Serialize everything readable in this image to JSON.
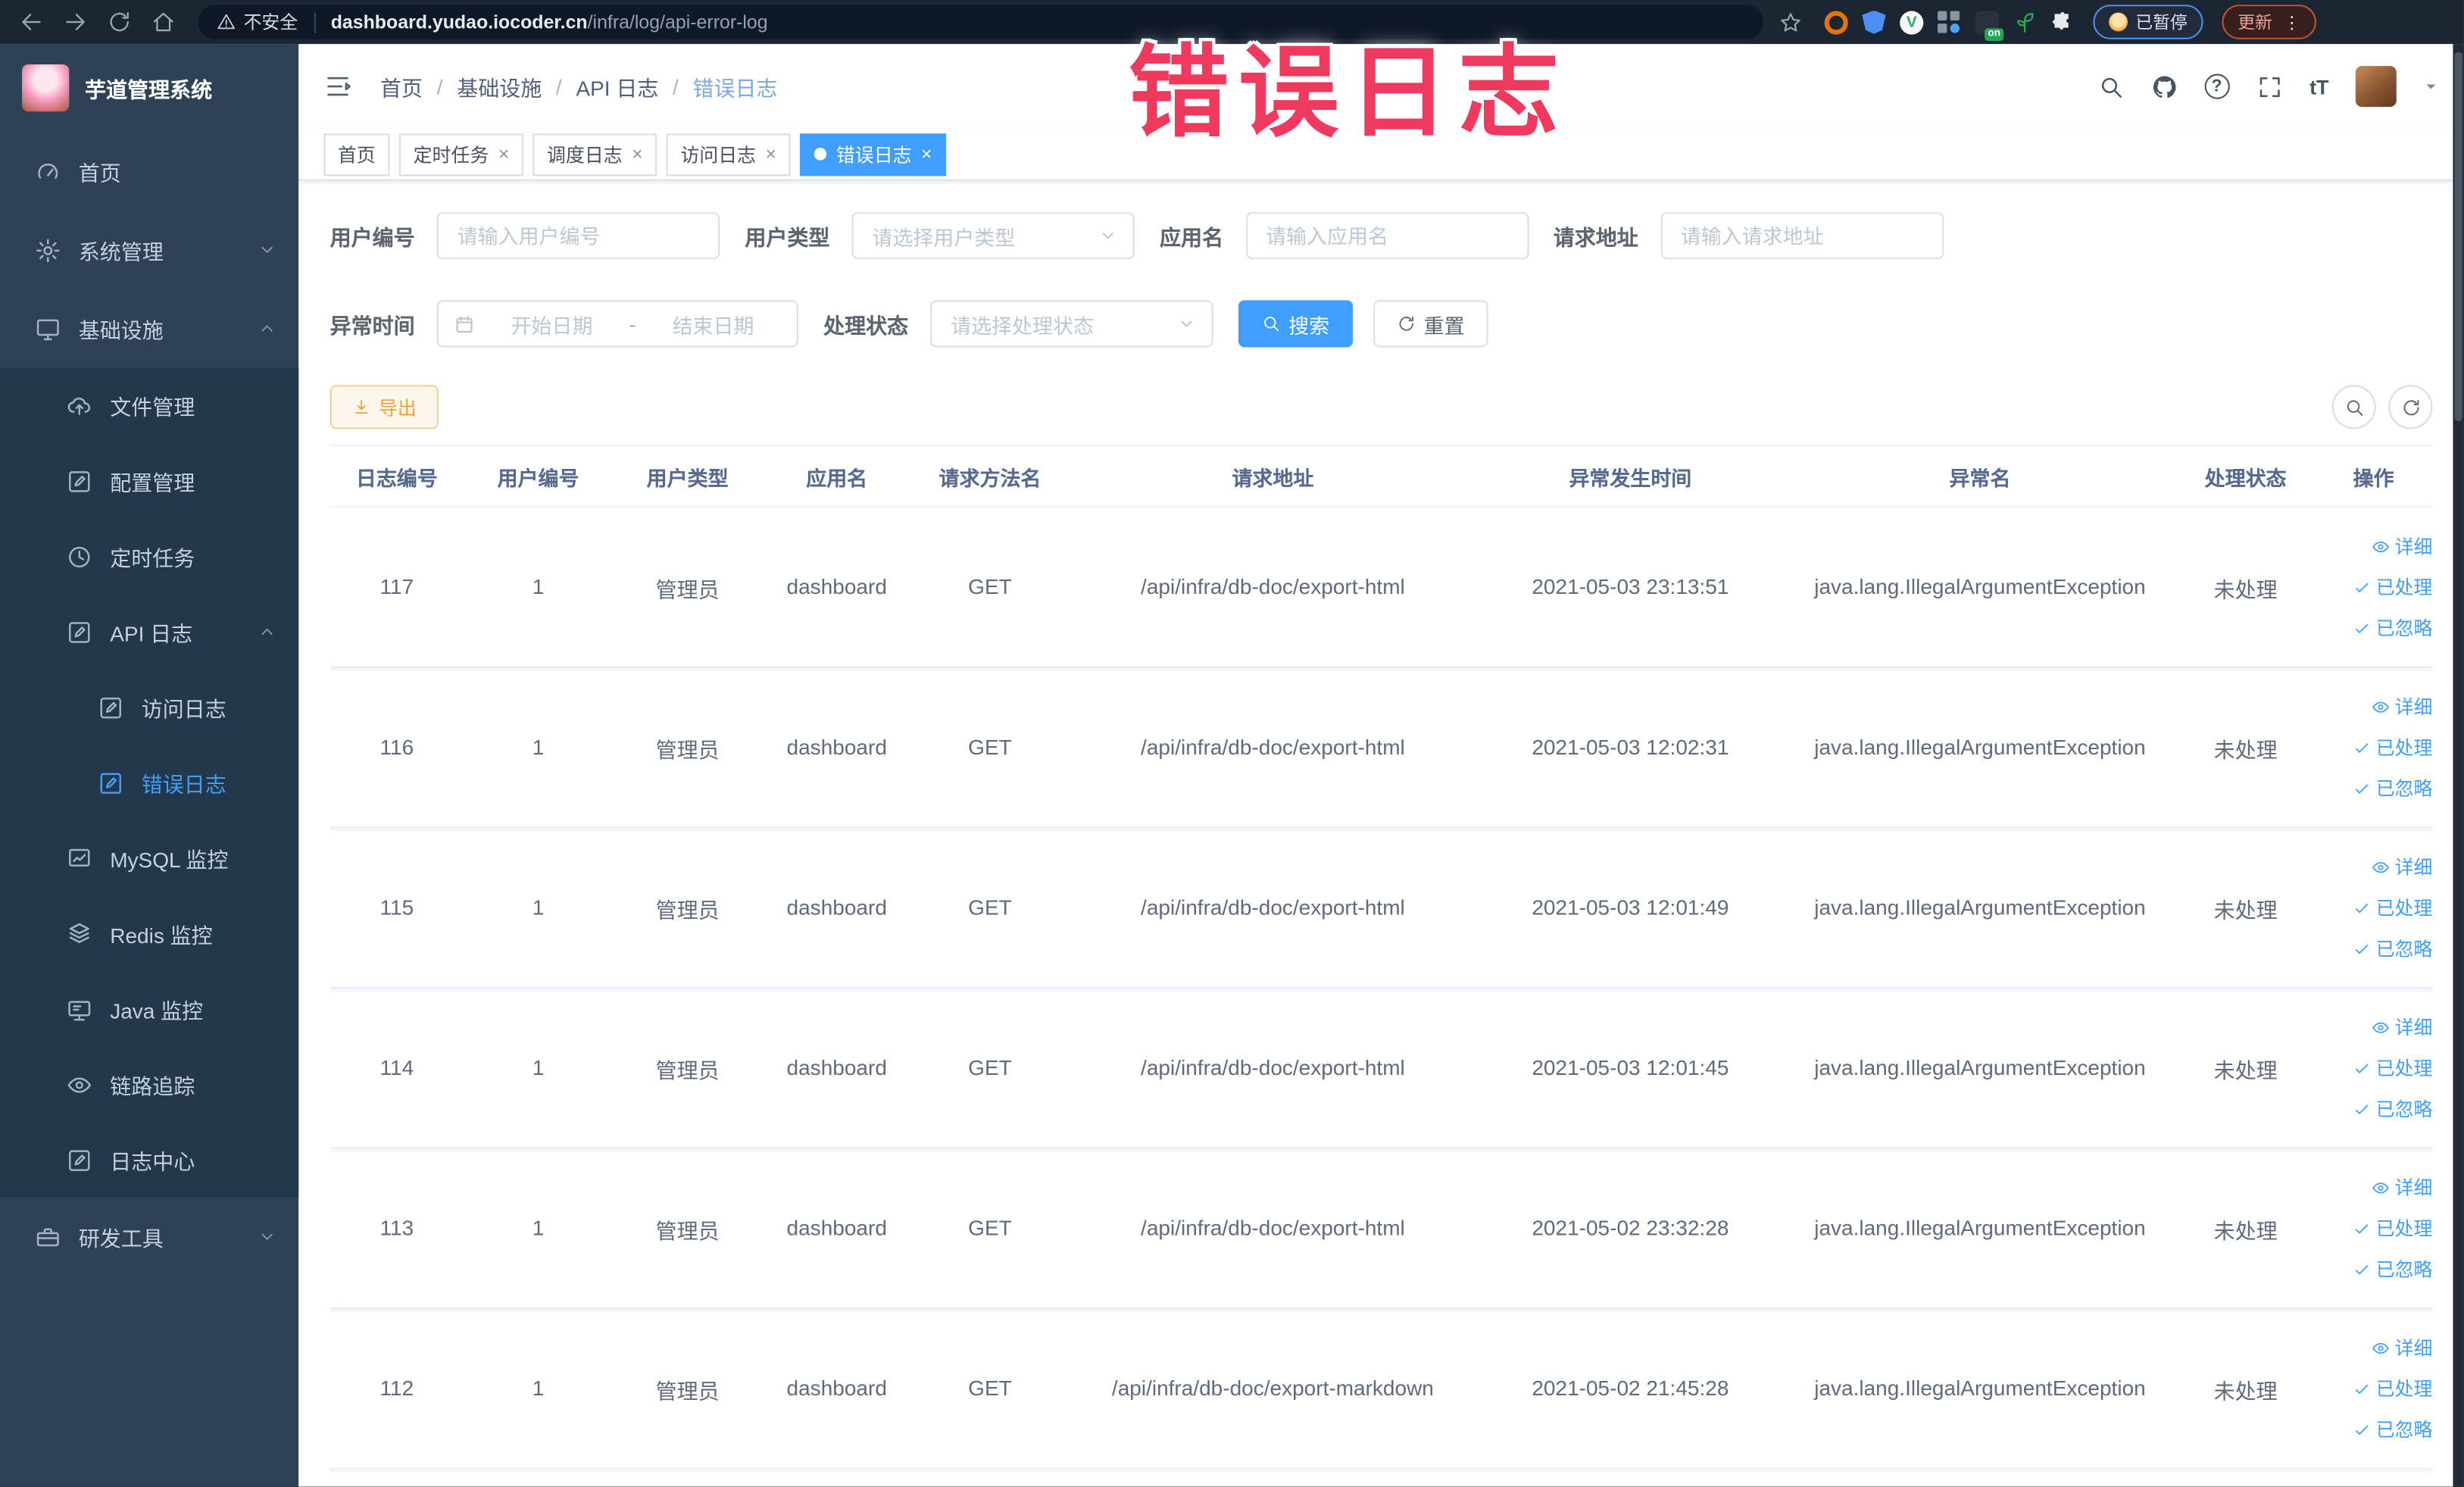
{
  "overlay": {
    "title": "错误日志"
  },
  "browser": {
    "security_label": "不安全",
    "url_domain": "dashboard.yudao.iocoder.cn",
    "url_path": "/infra/log/api-error-log",
    "extensions": {
      "vue_letter": "V",
      "on_badge": "on"
    },
    "paused_label": "已暂停",
    "update_label": "更新",
    "menu_glyph": "⋮"
  },
  "sidebar": {
    "title": "芋道管理系统",
    "home": "首页",
    "system": "系统管理",
    "infra": "基础设施",
    "file": "文件管理",
    "config": "配置管理",
    "job": "定时任务",
    "api_log": "API 日志",
    "access_log": "访问日志",
    "error_log": "错误日志",
    "mysql": "MySQL 监控",
    "redis": "Redis 监控",
    "java": "Java 监控",
    "trace": "链路追踪",
    "log_center": "日志中心",
    "dev_tools": "研发工具"
  },
  "header": {
    "breadcrumb": [
      "首页",
      "基础设施",
      "API 日志",
      "错误日志"
    ],
    "help_glyph": "?",
    "font_size_glyph": "tT"
  },
  "tabs": [
    {
      "label": "首页"
    },
    {
      "label": "定时任务"
    },
    {
      "label": "调度日志"
    },
    {
      "label": "访问日志"
    },
    {
      "label": "错误日志"
    }
  ],
  "filters": {
    "user_id_label": "用户编号",
    "user_id_placeholder": "请输入用户编号",
    "user_type_label": "用户类型",
    "user_type_placeholder": "请选择用户类型",
    "app_name_label": "应用名",
    "app_name_placeholder": "请输入应用名",
    "request_url_label": "请求地址",
    "request_url_placeholder": "请输入请求地址",
    "time_label": "异常时间",
    "time_start_placeholder": "开始日期",
    "time_separator": "-",
    "time_end_placeholder": "结束日期",
    "status_label": "处理状态",
    "status_placeholder": "请选择处理状态",
    "search_label": "搜索",
    "reset_label": "重置"
  },
  "toolbar": {
    "export_label": "导出"
  },
  "table": {
    "headers": [
      "日志编号",
      "用户编号",
      "用户类型",
      "应用名",
      "请求方法名",
      "请求地址",
      "异常发生时间",
      "异常名",
      "处理状态",
      "操作"
    ],
    "actions": {
      "detail": "详细",
      "processed": "已处理",
      "ignored": "已忽略"
    },
    "rows": [
      {
        "log_id": "117",
        "user_id": "1",
        "user_type": "管理员",
        "app_name": "dashboard",
        "method": "GET",
        "url": "/api/infra/db-doc/export-html",
        "time": "2021-05-03 23:13:51",
        "exception": "java.lang.IllegalArgumentException",
        "status": "未处理"
      },
      {
        "log_id": "116",
        "user_id": "1",
        "user_type": "管理员",
        "app_name": "dashboard",
        "method": "GET",
        "url": "/api/infra/db-doc/export-html",
        "time": "2021-05-03 12:02:31",
        "exception": "java.lang.IllegalArgumentException",
        "status": "未处理"
      },
      {
        "log_id": "115",
        "user_id": "1",
        "user_type": "管理员",
        "app_name": "dashboard",
        "method": "GET",
        "url": "/api/infra/db-doc/export-html",
        "time": "2021-05-03 12:01:49",
        "exception": "java.lang.IllegalArgumentException",
        "status": "未处理"
      },
      {
        "log_id": "114",
        "user_id": "1",
        "user_type": "管理员",
        "app_name": "dashboard",
        "method": "GET",
        "url": "/api/infra/db-doc/export-html",
        "time": "2021-05-03 12:01:45",
        "exception": "java.lang.IllegalArgumentException",
        "status": "未处理"
      },
      {
        "log_id": "113",
        "user_id": "1",
        "user_type": "管理员",
        "app_name": "dashboard",
        "method": "GET",
        "url": "/api/infra/db-doc/export-html",
        "time": "2021-05-02 23:32:28",
        "exception": "java.lang.IllegalArgumentException",
        "status": "未处理"
      },
      {
        "log_id": "112",
        "user_id": "1",
        "user_type": "管理员",
        "app_name": "dashboard",
        "method": "GET",
        "url": "/api/infra/db-doc/export-markdown",
        "time": "2021-05-02 21:45:28",
        "exception": "java.lang.IllegalArgumentException",
        "status": "未处理"
      }
    ]
  },
  "colors": {
    "accent": "#409eff",
    "warning": "#e6a23c",
    "overlay_pink": "#ef3a5e",
    "sidebar_bg": "#2f4156"
  }
}
